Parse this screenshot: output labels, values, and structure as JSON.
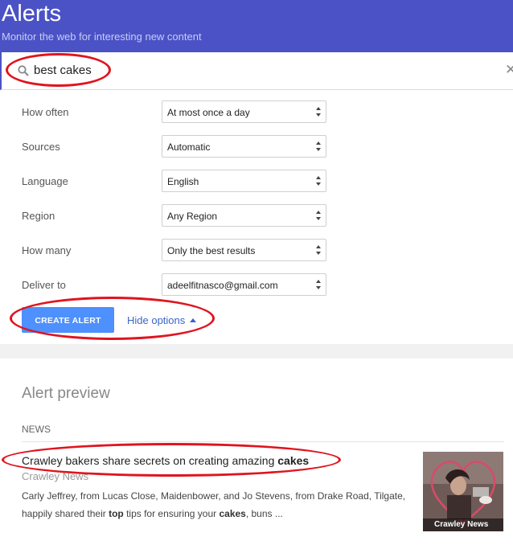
{
  "header": {
    "title": "Alerts",
    "subtitle": "Monitor the web for interesting new content"
  },
  "search": {
    "query": "best cakes",
    "icon": "search-icon",
    "clear_icon": "close-icon"
  },
  "options": [
    {
      "label": "How often",
      "value": "At most once a day"
    },
    {
      "label": "Sources",
      "value": "Automatic"
    },
    {
      "label": "Language",
      "value": "English"
    },
    {
      "label": "Region",
      "value": "Any Region"
    },
    {
      "label": "How many",
      "value": "Only the best results"
    },
    {
      "label": "Deliver to",
      "value": "adeelfitnasco@gmail.com"
    }
  ],
  "actions": {
    "create_label": "CREATE ALERT",
    "hide_label": "Hide options"
  },
  "preview": {
    "title": "Alert preview",
    "section": "NEWS",
    "article": {
      "title_pre": "Crawley bakers share secrets on creating amazing ",
      "title_bold": "cakes",
      "source": "Crawley News",
      "snippet_1": "Carly Jeffrey, from Lucas Close, Maidenbower, and Jo Stevens, from Drake Road, Tilgate, happily shared their ",
      "snippet_bold_1": "top",
      "snippet_2": " tips for ensuring your ",
      "snippet_bold_2": "cakes",
      "snippet_3": ", buns ...",
      "thumb_caption": "Crawley News"
    }
  },
  "colors": {
    "header_bg": "#4a52c6",
    "button_bg": "#4d90fe",
    "link": "#3b63c9",
    "annotation": "#e0141e"
  }
}
